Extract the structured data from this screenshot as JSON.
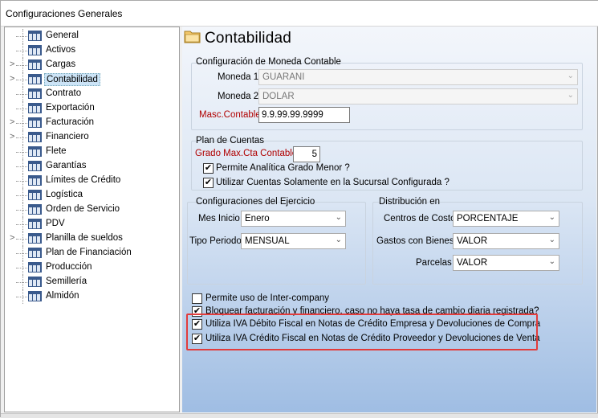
{
  "window": {
    "title": "Configuraciones Generales"
  },
  "tree": {
    "items": [
      {
        "label": "General",
        "expander": ""
      },
      {
        "label": "Activos",
        "expander": ""
      },
      {
        "label": "Cargas",
        "expander": ">"
      },
      {
        "label": "Contabilidad",
        "expander": ">",
        "selected": true
      },
      {
        "label": "Contrato",
        "expander": ""
      },
      {
        "label": "Exportación",
        "expander": ""
      },
      {
        "label": "Facturación",
        "expander": ">"
      },
      {
        "label": "Financiero",
        "expander": ">"
      },
      {
        "label": "Flete",
        "expander": ""
      },
      {
        "label": "Garantías",
        "expander": ""
      },
      {
        "label": "Límites de Crédito",
        "expander": ""
      },
      {
        "label": "Logística",
        "expander": ""
      },
      {
        "label": "Orden de Servicio",
        "expander": ""
      },
      {
        "label": "PDV",
        "expander": ""
      },
      {
        "label": "Planilla de sueldos",
        "expander": ">"
      },
      {
        "label": "Plan de Financiación",
        "expander": ""
      },
      {
        "label": "Producción",
        "expander": ""
      },
      {
        "label": "Semillería",
        "expander": ""
      },
      {
        "label": "Almidón",
        "expander": ""
      }
    ]
  },
  "panel": {
    "title": "Contabilidad",
    "moneda": {
      "group_title": "Configuración de Moneda Contable",
      "moneda1_label": "Moneda 1",
      "moneda1_value": "GUARANI",
      "moneda2_label": "Moneda 2",
      "moneda2_value": "DOLAR",
      "masc_label": "Masc.Contable",
      "masc_value": "9.9.99.99.9999"
    },
    "plan": {
      "group_title": "Plan de Cuentas",
      "grado_label": "Grado Max.Cta Contable",
      "grado_value": "5",
      "analitica_label": "Permite Analítica Grado Menor ?",
      "analitica_checked": true,
      "cuentas_label": "Utilizar Cuentas Solamente en la Sucursal Configurada ?",
      "cuentas_checked": true
    },
    "ejercicio": {
      "group_title": "Configuraciones del Ejercicio",
      "mes_label": "Mes Inicio",
      "mes_value": "Enero",
      "tipo_label": "Tipo Periodo",
      "tipo_value": "MENSUAL"
    },
    "distribucion": {
      "group_title": "Distribución en",
      "centros_label": "Centros de Costo",
      "centros_value": "PORCENTAJE",
      "gastos_label": "Gastos con Bienes",
      "gastos_value": "VALOR",
      "parcelas_label": "Parcelas",
      "parcelas_value": "VALOR"
    },
    "options": [
      {
        "label": "Permite uso de Inter-company",
        "checked": false
      },
      {
        "label": "Bloquear facturación y financiero, caso no haya tasa de cambio diaria registrada?",
        "checked": true
      },
      {
        "label": "Utiliza IVA Débito Fiscal en Notas de Crédito Empresa y Devoluciones de Compra",
        "checked": true
      },
      {
        "label": "Utiliza IVA Crédito Fiscal en Notas de Crédito Proveedor y Devoluciones de Venta",
        "checked": true
      }
    ]
  },
  "colors": {
    "highlight": "#e23c3c",
    "required_label": "#b00000",
    "selected_item": "#cce4f7"
  },
  "icons": {
    "tree_item": "table-icon",
    "header": "folder-icon",
    "dropdown": "chevron-down-icon",
    "checkbox": "check-icon"
  }
}
